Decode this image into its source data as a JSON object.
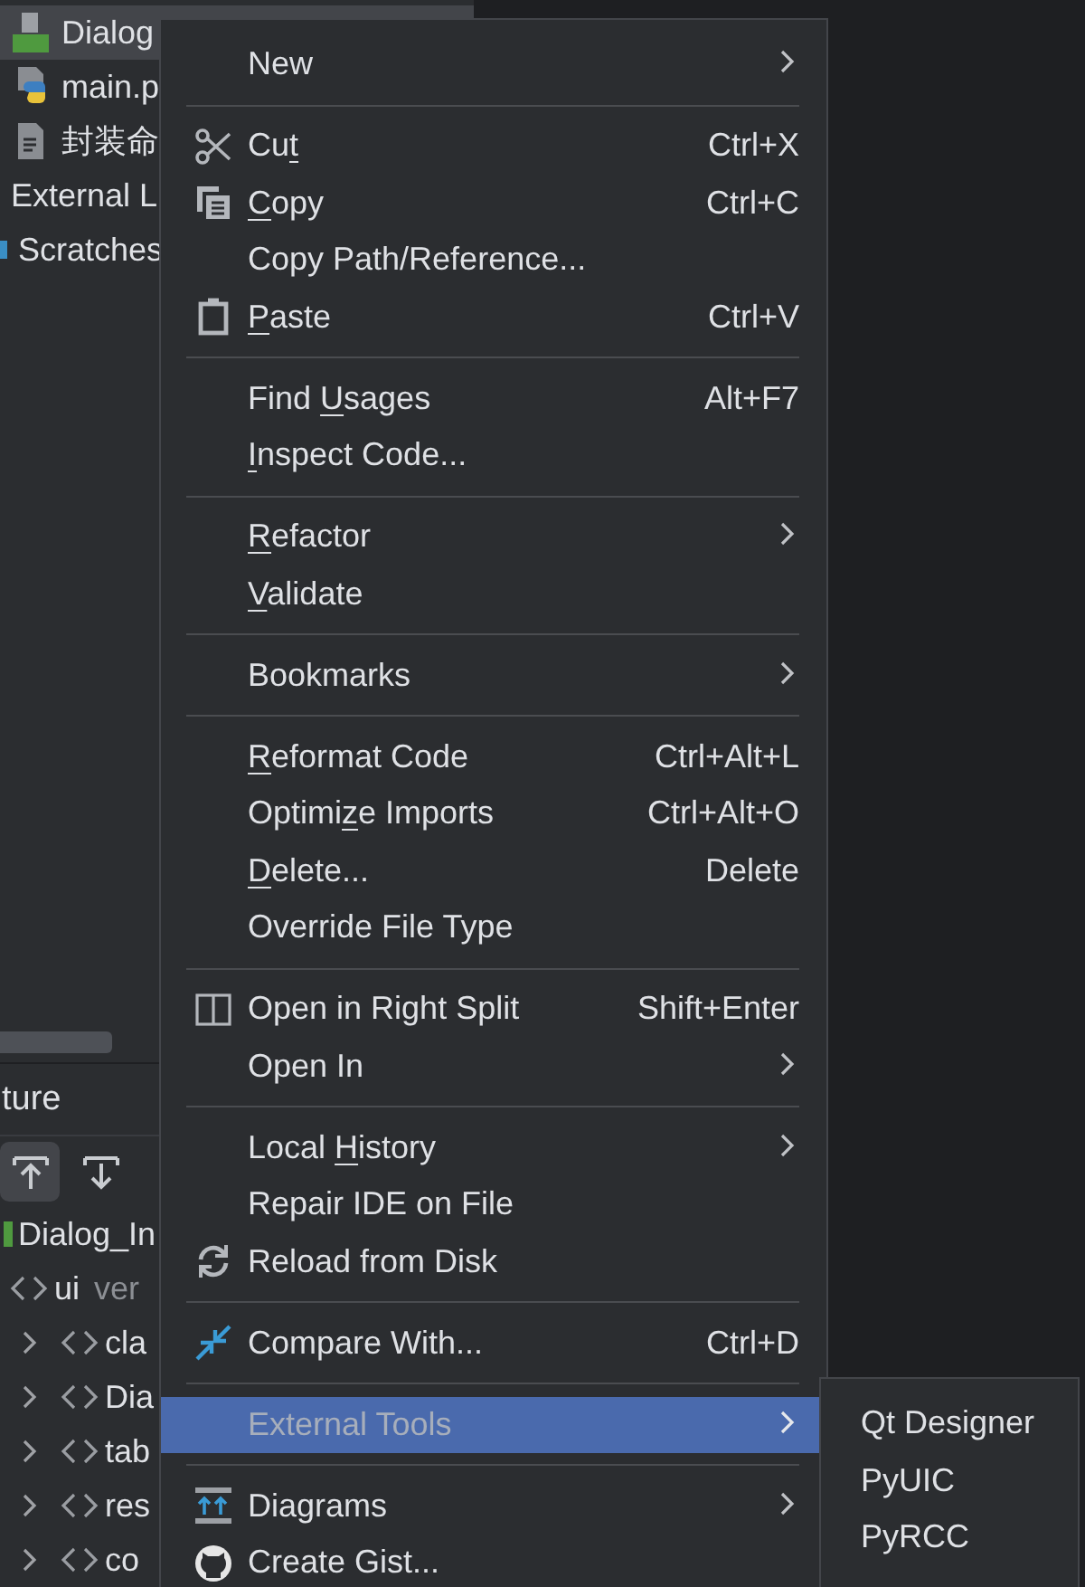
{
  "project_tree": {
    "items": [
      {
        "label": "Dialog",
        "selected": true
      },
      {
        "label": "main.p",
        "selected": false
      },
      {
        "label": "封装命",
        "selected": false
      },
      {
        "label": "External L",
        "selected": false
      },
      {
        "label": "Scratches",
        "selected": false
      }
    ]
  },
  "structure": {
    "title": "ture",
    "items": [
      {
        "label": "Dialog_In",
        "children": [
          {
            "label": "ui",
            "detail": "ver",
            "children": [
              {
                "label": "cla",
                "expanded": false
              },
              {
                "label": "Dia",
                "expanded": false
              },
              {
                "label": "tab",
                "expanded": false
              },
              {
                "label": "res",
                "expanded": false
              },
              {
                "label": "co",
                "expanded": false
              }
            ]
          }
        ]
      }
    ]
  },
  "context_menu": {
    "sections": [
      {
        "items": [
          {
            "label": "New",
            "submenu": true,
            "selected": false
          }
        ]
      },
      {
        "items": [
          {
            "before": "Cu",
            "key": "t",
            "shortcut": "Ctrl+X",
            "submenu": false,
            "selected": false
          },
          {
            "key": "C",
            "after": "opy",
            "shortcut": "Ctrl+C",
            "submenu": false,
            "selected": false
          },
          {
            "label": "Copy Path/Reference...",
            "submenu": false,
            "selected": false
          },
          {
            "key": "P",
            "after": "aste",
            "shortcut": "Ctrl+V",
            "submenu": false,
            "selected": false
          }
        ]
      },
      {
        "items": [
          {
            "before": "Find ",
            "key": "U",
            "after": "sages",
            "shortcut": "Alt+F7",
            "submenu": false,
            "selected": false
          },
          {
            "key": "I",
            "after": "nspect Code...",
            "submenu": false,
            "selected": false
          }
        ]
      },
      {
        "items": [
          {
            "key": "R",
            "after": "efactor",
            "submenu": true,
            "selected": false
          },
          {
            "key": "V",
            "after": "alidate",
            "submenu": false,
            "selected": false
          }
        ]
      },
      {
        "items": [
          {
            "label": "Bookmarks",
            "submenu": true,
            "selected": false
          }
        ]
      },
      {
        "items": [
          {
            "key": "R",
            "after": "eformat Code",
            "shortcut": "Ctrl+Alt+L",
            "submenu": false,
            "selected": false
          },
          {
            "before": "Optimi",
            "key": "z",
            "after": "e Imports",
            "shortcut": "Ctrl+Alt+O",
            "submenu": false,
            "selected": false
          },
          {
            "key": "D",
            "after": "elete...",
            "shortcut": "Delete",
            "submenu": false,
            "selected": false
          },
          {
            "label": "Override File Type",
            "submenu": false,
            "selected": false
          }
        ]
      },
      {
        "items": [
          {
            "label": "Open in Right Split",
            "shortcut": "Shift+Enter",
            "submenu": false,
            "selected": false
          },
          {
            "label": "Open In",
            "submenu": true,
            "selected": false
          }
        ]
      },
      {
        "items": [
          {
            "before": "Local ",
            "key": "H",
            "after": "istory",
            "submenu": true,
            "selected": false
          },
          {
            "label": "Repair IDE on File",
            "submenu": false,
            "selected": false
          },
          {
            "label": "Reload from Disk",
            "submenu": false,
            "selected": false
          }
        ]
      },
      {
        "items": [
          {
            "label": "Compare With...",
            "shortcut": "Ctrl+D",
            "submenu": false,
            "selected": false
          }
        ]
      },
      {
        "items": [
          {
            "label": "External Tools",
            "submenu": true,
            "selected": true
          }
        ]
      },
      {
        "items": [
          {
            "label": "Diagrams",
            "submenu": true,
            "selected": false
          },
          {
            "label": "Create Gist...",
            "submenu": false,
            "selected": false
          }
        ]
      }
    ]
  },
  "submenu": {
    "items": [
      {
        "label": "Qt Designer"
      },
      {
        "label": "PyUIC"
      },
      {
        "label": "PyRCC"
      }
    ]
  }
}
